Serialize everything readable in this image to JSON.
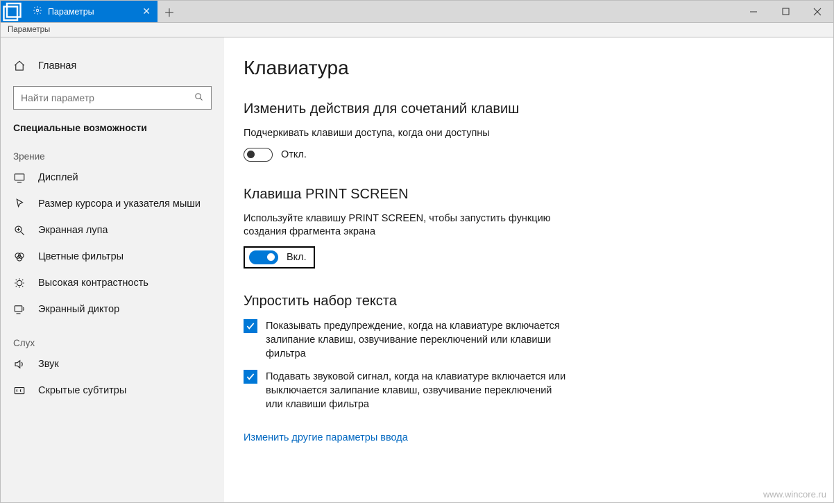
{
  "window": {
    "tab_title": "Параметры",
    "breadcrumb": "Параметры"
  },
  "sidebar": {
    "home": "Главная",
    "search_placeholder": "Найти параметр",
    "category": "Специальные возможности",
    "group_vision": "Зрение",
    "items_vision": [
      "Дисплей",
      "Размер курсора и указателя мыши",
      "Экранная лупа",
      "Цветные фильтры",
      "Высокая контрастность",
      "Экранный диктор"
    ],
    "group_hearing": "Слух",
    "items_hearing": [
      "Звук",
      "Скрытые субтитры"
    ]
  },
  "content": {
    "title": "Клавиатура",
    "sec1_title": "Изменить действия для сочетаний клавиш",
    "sec1_desc": "Подчеркивать клавиши доступа, когда они доступны",
    "sec1_toggle_state": "Откл.",
    "sec2_title": "Клавиша PRINT SCREEN",
    "sec2_desc": "Используйте клавишу PRINT SCREEN, чтобы запустить функцию создания фрагмента экрана",
    "sec2_toggle_state": "Вкл.",
    "sec3_title": "Упростить набор текста",
    "sec3_chk1": "Показывать предупреждение, когда на клавиатуре включается залипание клавиш, озвучивание переключений или клавиши фильтра",
    "sec3_chk2": "Подавать звуковой сигнал, когда на клавиатуре включается или выключается залипание клавиш, озвучивание переключений или клавиши фильтра",
    "link": "Изменить другие параметры ввода"
  },
  "watermark": "www.wincore.ru"
}
